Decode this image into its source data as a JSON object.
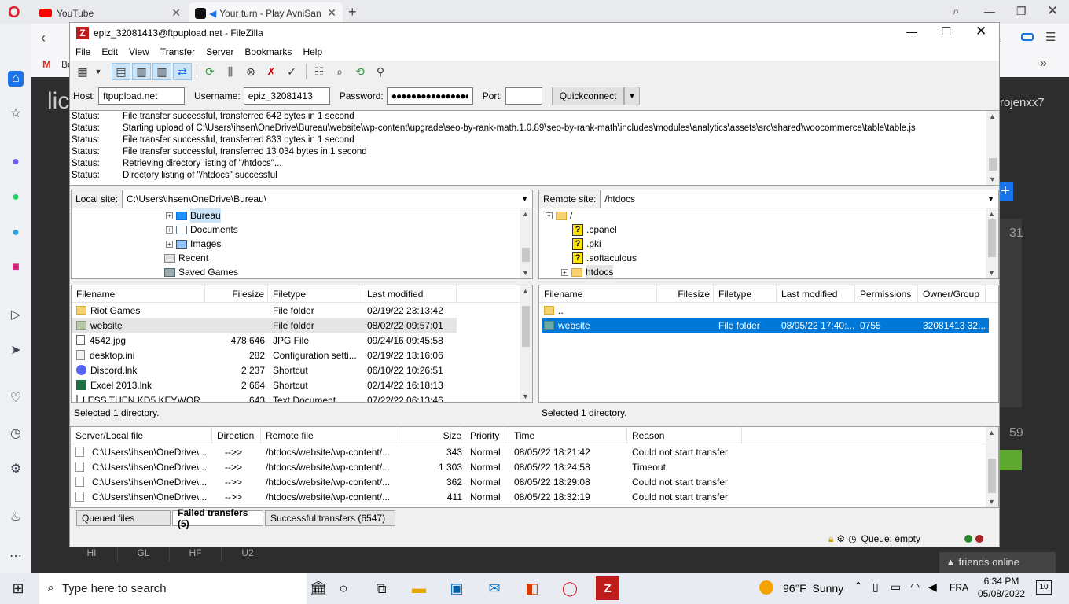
{
  "browser": {
    "tabs": [
      {
        "label": "YouTube",
        "icon": "youtube-icon"
      },
      {
        "label": "Your turn - Play AvniSan",
        "icon": "game-icon"
      }
    ],
    "bookmark_letter": "Bo",
    "bookmarks_more": "»"
  },
  "webpage": {
    "left_text": "lic",
    "right_text": "rojenxx7",
    "num1": "31",
    "num2": "59",
    "bottom_tabs": [
      "HI",
      "GL",
      "HF",
      "U2"
    ],
    "friends": "friends online"
  },
  "filezilla": {
    "title": "epiz_32081413@ftpupload.net - FileZilla",
    "menu": [
      "File",
      "Edit",
      "View",
      "Transfer",
      "Server",
      "Bookmarks",
      "Help"
    ],
    "quick": {
      "host_label": "Host:",
      "host_value": "ftpupload.net",
      "user_label": "Username:",
      "user_value": "epiz_32081413",
      "pass_label": "Password:",
      "pass_value": "●●●●●●●●●●●●●●●●",
      "port_label": "Port:",
      "port_value": "",
      "connect_label": "Quickconnect"
    },
    "log": [
      {
        "status": "Status:",
        "msg": "File transfer successful, transferred 642 bytes in 1 second"
      },
      {
        "status": "Status:",
        "msg": "Starting upload of C:\\Users\\ihsen\\OneDrive\\Bureau\\website\\wp-content\\upgrade\\seo-by-rank-math.1.0.89\\seo-by-rank-math\\includes\\modules\\analytics\\assets\\src\\shared\\woocommerce\\table\\table.js"
      },
      {
        "status": "Status:",
        "msg": "File transfer successful, transferred 833 bytes in 1 second"
      },
      {
        "status": "Status:",
        "msg": "File transfer successful, transferred 13 034 bytes in 1 second"
      },
      {
        "status": "Status:",
        "msg": "Retrieving directory listing of \"/htdocs\"..."
      },
      {
        "status": "Status:",
        "msg": "Directory listing of \"/htdocs\" successful"
      }
    ],
    "local": {
      "label": "Local site:",
      "path": "C:\\Users\\ihsen\\OneDrive\\Bureau\\",
      "tree": [
        "Bureau",
        "Documents",
        "Images",
        "Recent",
        "Saved Games"
      ],
      "headers": [
        "Filename",
        "Filesize",
        "Filetype",
        "Last modified"
      ],
      "files": [
        {
          "name": "Riot Games",
          "size": "",
          "type": "File folder",
          "modified": "02/19/22 23:13:42"
        },
        {
          "name": "website",
          "size": "",
          "type": "File folder",
          "modified": "08/02/22 09:57:01"
        },
        {
          "name": "4542.jpg",
          "size": "478 646",
          "type": "JPG File",
          "modified": "09/24/16 09:45:58"
        },
        {
          "name": "desktop.ini",
          "size": "282",
          "type": "Configuration setti...",
          "modified": "02/19/22 13:16:06"
        },
        {
          "name": "Discord.lnk",
          "size": "2 237",
          "type": "Shortcut",
          "modified": "06/10/22 10:26:51"
        },
        {
          "name": "Excel 2013.lnk",
          "size": "2 664",
          "type": "Shortcut",
          "modified": "02/14/22 16:18:13"
        },
        {
          "name": "LESS THEN KD5 KEYWOR...",
          "size": "643",
          "type": "Text Document",
          "modified": "07/22/22 06:13:46"
        }
      ],
      "status": "Selected 1 directory."
    },
    "remote": {
      "label": "Remote site:",
      "path": "/htdocs",
      "tree": [
        "/",
        ".cpanel",
        ".pki",
        ".softaculous",
        "htdocs"
      ],
      "headers": [
        "Filename",
        "Filesize",
        "Filetype",
        "Last modified",
        "Permissions",
        "Owner/Group"
      ],
      "files": [
        {
          "name": "..",
          "size": "",
          "type": "",
          "modified": "",
          "perm": "",
          "owner": ""
        },
        {
          "name": "website",
          "size": "",
          "type": "File folder",
          "modified": "08/05/22 17:40:...",
          "perm": "0755",
          "owner": "32081413 32..."
        }
      ],
      "status": "Selected 1 directory."
    },
    "queue": {
      "headers": [
        "Server/Local file",
        "Direction",
        "Remote file",
        "Size",
        "Priority",
        "Time",
        "Reason"
      ],
      "rows": [
        {
          "local": "C:\\Users\\ihsen\\OneDrive\\...",
          "dir": "-->>",
          "remote": "/htdocs/website/wp-content/...",
          "size": "343",
          "priority": "Normal",
          "time": "08/05/22 18:21:42",
          "reason": "Could not start transfer"
        },
        {
          "local": "C:\\Users\\ihsen\\OneDrive\\...",
          "dir": "-->>",
          "remote": "/htdocs/website/wp-content/...",
          "size": "1 303",
          "priority": "Normal",
          "time": "08/05/22 18:24:58",
          "reason": "Timeout"
        },
        {
          "local": "C:\\Users\\ihsen\\OneDrive\\...",
          "dir": "-->>",
          "remote": "/htdocs/website/wp-content/...",
          "size": "362",
          "priority": "Normal",
          "time": "08/05/22 18:29:08",
          "reason": "Could not start transfer"
        },
        {
          "local": "C:\\Users\\ihsen\\OneDrive\\...",
          "dir": "-->>",
          "remote": "/htdocs/website/wp-content/...",
          "size": "411",
          "priority": "Normal",
          "time": "08/05/22 18:32:19",
          "reason": "Could not start transfer"
        }
      ],
      "tabs": [
        "Queued files",
        "Failed transfers (5)",
        "Successful transfers (6547)"
      ],
      "status_text": "Queue: empty"
    }
  },
  "taskbar": {
    "search_placeholder": "Type here to search",
    "weather": "96°F  Sunny",
    "lang": "FRA",
    "time": "6:34 PM",
    "date": "05/08/2022",
    "notif_count": "10"
  },
  "colors": {
    "accent": "#0078d7",
    "fz_red": "#bf1c1c",
    "opera_red": "#e5202e"
  }
}
